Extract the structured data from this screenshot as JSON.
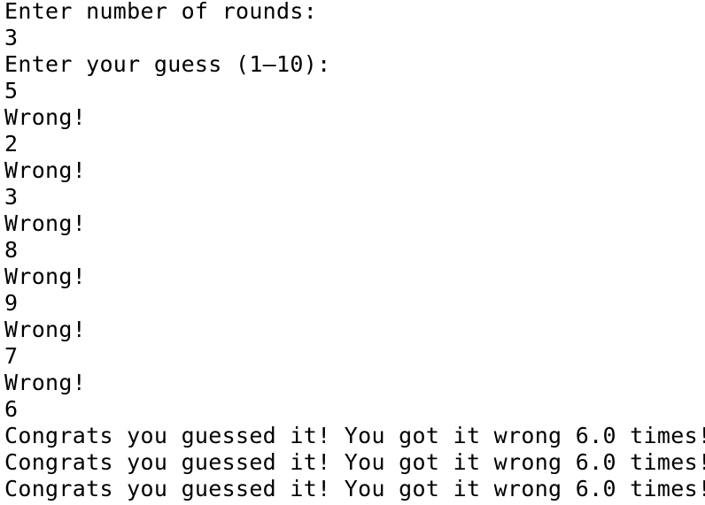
{
  "terminal": {
    "lines": [
      "Enter number of rounds:",
      "3",
      "Enter your guess (1–10):",
      "5",
      "Wrong!",
      "2",
      "Wrong!",
      "3",
      "Wrong!",
      "8",
      "Wrong!",
      "9",
      "Wrong!",
      "7",
      "Wrong!",
      "6",
      "Congrats you guessed it! You got it wrong 6.0 times!",
      "Congrats you guessed it! You got it wrong 6.0 times!",
      "Congrats you guessed it! You got it wrong 6.0 times!"
    ]
  }
}
